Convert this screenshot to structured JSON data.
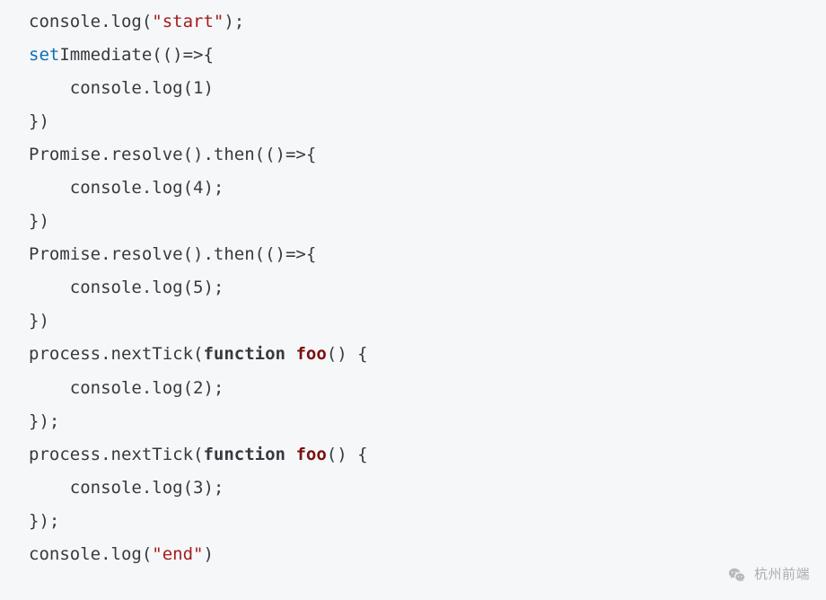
{
  "code": {
    "tokens": [
      [
        {
          "t": "console.log(",
          "c": "plain"
        },
        {
          "t": "\"start\"",
          "c": "tok-str"
        },
        {
          "t": ");",
          "c": "plain"
        }
      ],
      [
        {
          "t": "set",
          "c": "tok-kw"
        },
        {
          "t": "Immediate(()=>{",
          "c": "plain"
        }
      ],
      [
        {
          "t": "    console.log(",
          "c": "plain"
        },
        {
          "t": "1",
          "c": "tok-num"
        },
        {
          "t": ")",
          "c": "plain"
        }
      ],
      [
        {
          "t": "})",
          "c": "plain"
        }
      ],
      [
        {
          "t": "Promise.resolve().then(()=>{",
          "c": "plain"
        }
      ],
      [
        {
          "t": "    console.log(",
          "c": "plain"
        },
        {
          "t": "4",
          "c": "tok-num"
        },
        {
          "t": ");",
          "c": "plain"
        }
      ],
      [
        {
          "t": "})",
          "c": "plain"
        }
      ],
      [
        {
          "t": "Promise.resolve().then(()=>{",
          "c": "plain"
        }
      ],
      [
        {
          "t": "    console.log(",
          "c": "plain"
        },
        {
          "t": "5",
          "c": "tok-num"
        },
        {
          "t": ");",
          "c": "plain"
        }
      ],
      [
        {
          "t": "})",
          "c": "plain"
        }
      ],
      [
        {
          "t": "process.nextTick(",
          "c": "plain"
        },
        {
          "t": "function",
          "c": "tok-fnkey"
        },
        {
          "t": " ",
          "c": "plain"
        },
        {
          "t": "foo",
          "c": "tok-fname"
        },
        {
          "t": "() {",
          "c": "plain"
        }
      ],
      [
        {
          "t": "    console.log(",
          "c": "plain"
        },
        {
          "t": "2",
          "c": "tok-num"
        },
        {
          "t": ");",
          "c": "plain"
        }
      ],
      [
        {
          "t": "});",
          "c": "plain"
        }
      ],
      [
        {
          "t": "process.nextTick(",
          "c": "plain"
        },
        {
          "t": "function",
          "c": "tok-fnkey"
        },
        {
          "t": " ",
          "c": "plain"
        },
        {
          "t": "foo",
          "c": "tok-fname"
        },
        {
          "t": "() {",
          "c": "plain"
        }
      ],
      [
        {
          "t": "    console.log(",
          "c": "plain"
        },
        {
          "t": "3",
          "c": "tok-num"
        },
        {
          "t": ");",
          "c": "plain"
        }
      ],
      [
        {
          "t": "});",
          "c": "plain"
        }
      ],
      [
        {
          "t": "console.log(",
          "c": "plain"
        },
        {
          "t": "\"end\"",
          "c": "tok-str"
        },
        {
          "t": ")",
          "c": "plain"
        }
      ]
    ]
  },
  "watermark": {
    "label": "杭州前端"
  }
}
